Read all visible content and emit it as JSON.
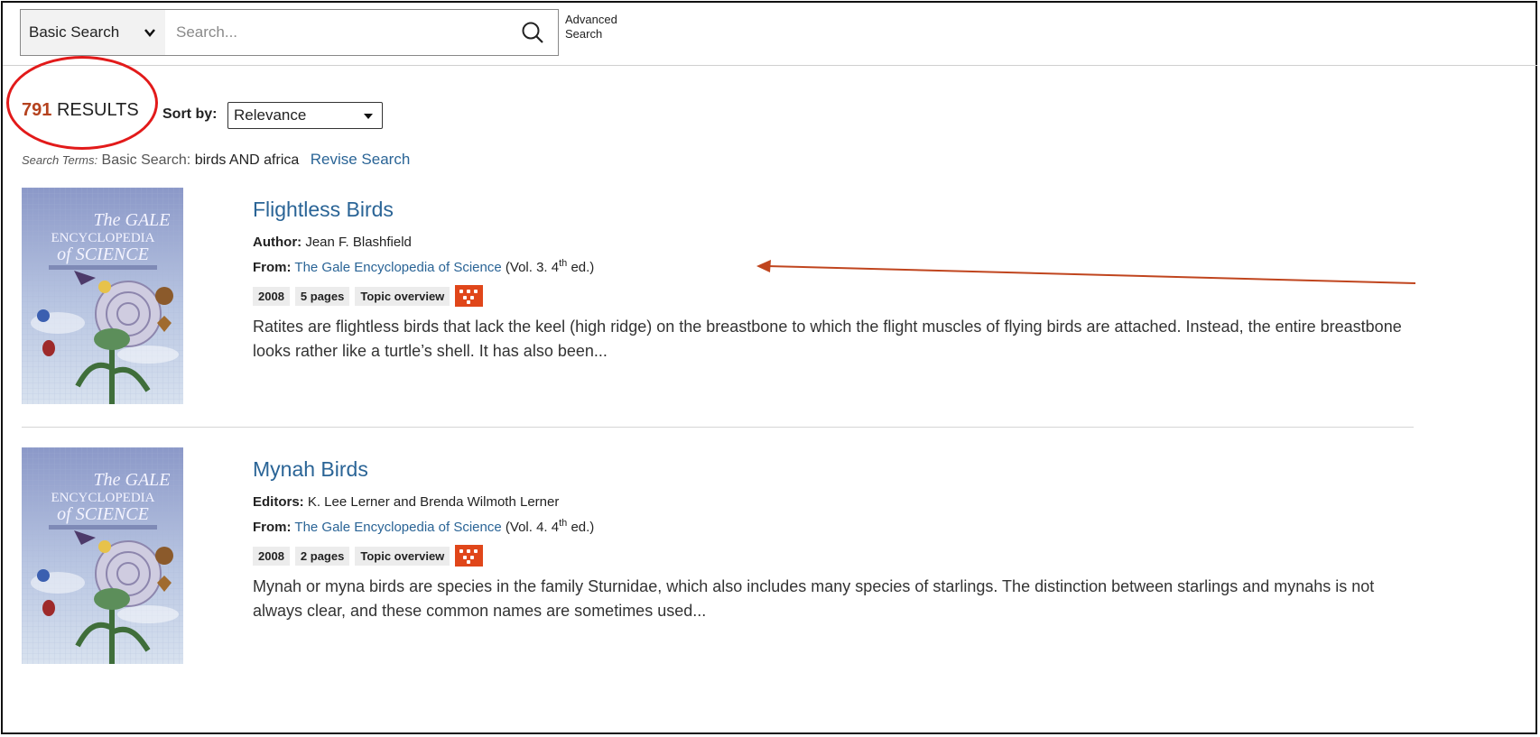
{
  "search": {
    "type_label": "Basic Search",
    "placeholder": "Search...",
    "advanced_line1": "Advanced",
    "advanced_line2": "Search"
  },
  "results": {
    "count": "791",
    "count_label": "RESULTS",
    "sort_label": "Sort by:",
    "sort_value": "Relevance",
    "terms_label": "Search Terms:",
    "terms_type": "Basic Search:",
    "terms_query": "birds AND africa",
    "revise_label": "Revise Search"
  },
  "items": [
    {
      "title": "Flightless Birds",
      "author_label": "Author:",
      "author": "Jean F. Blashfield",
      "from_label": "From:",
      "source": "The Gale Encyclopedia of Science",
      "vol_pre": "(Vol. 3. 4",
      "vol_sup": "th",
      "vol_post": " ed.)",
      "year": "2008",
      "pages": "5 pages",
      "doc_type": "Topic overview",
      "snippet": "Ratites are flightless birds that lack the keel (high ridge) on the breastbone to which the flight muscles of flying birds are attached. Instead, the entire breastbone looks rather like a turtle’s shell. It has also been..."
    },
    {
      "title": "Mynah Birds",
      "author_label": "Editors:",
      "author": "K. Lee Lerner and Brenda Wilmoth Lerner",
      "from_label": "From:",
      "source": "The Gale Encyclopedia of Science",
      "vol_pre": "(Vol. 4. 4",
      "vol_sup": "th",
      "vol_post": " ed.)",
      "year": "2008",
      "pages": "2 pages",
      "doc_type": "Topic overview",
      "snippet": "Mynah or myna birds are species in the family Sturnidae, which also includes many species of starlings. The distinction between starlings and mynahs is not always clear, and these common names are sometimes used..."
    }
  ],
  "cover": {
    "line1": "The GALE",
    "line2": "ENCYCLOPEDIA",
    "line3": "of SCIENCE"
  },
  "colors": {
    "link": "#2a6496",
    "count": "#b5421e",
    "annotation_circle": "#e21a1a",
    "annotation_arrow": "#c0451e",
    "topic_icon": "#e0461a"
  }
}
